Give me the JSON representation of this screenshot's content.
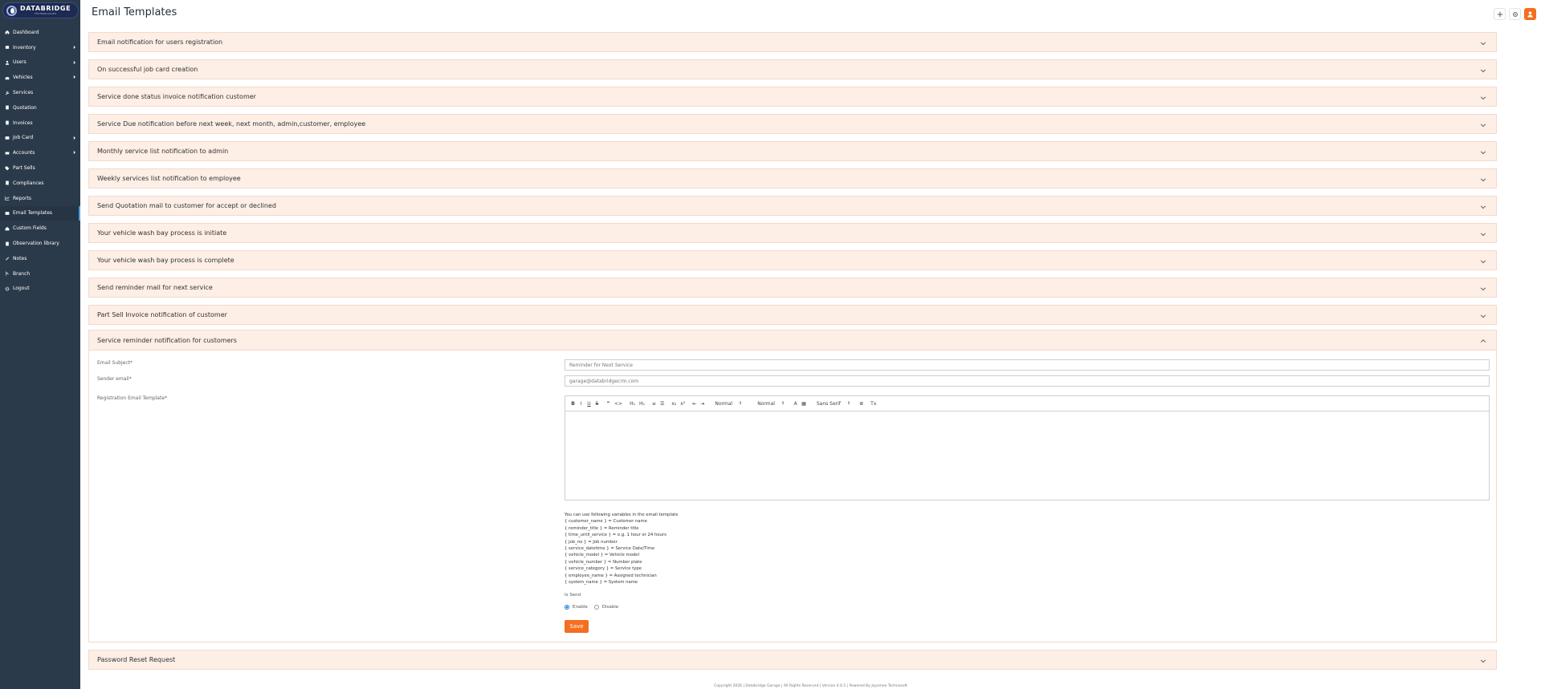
{
  "brand": {
    "name": "DATABRIDGE",
    "tagline": "TECHNOLOGIES"
  },
  "page": {
    "title": "Email Templates"
  },
  "sidebar": {
    "items": [
      {
        "label": "Dashboard",
        "icon": "home-icon",
        "has_children": false
      },
      {
        "label": "Inventory",
        "icon": "box-icon",
        "has_children": true
      },
      {
        "label": "Users",
        "icon": "user-icon",
        "has_children": true
      },
      {
        "label": "Vehicles",
        "icon": "car-icon",
        "has_children": true
      },
      {
        "label": "Services",
        "icon": "wrench-icon",
        "has_children": false
      },
      {
        "label": "Quotation",
        "icon": "document-icon",
        "has_children": false
      },
      {
        "label": "Invoices",
        "icon": "invoice-icon",
        "has_children": false
      },
      {
        "label": "Job Card",
        "icon": "card-icon",
        "has_children": true
      },
      {
        "label": "Accounts",
        "icon": "money-icon",
        "has_children": true
      },
      {
        "label": "Part Sells",
        "icon": "tag-icon",
        "has_children": false
      },
      {
        "label": "Compliances",
        "icon": "file-icon",
        "has_children": false
      },
      {
        "label": "Reports",
        "icon": "chart-icon",
        "has_children": false
      },
      {
        "label": "Email Templates",
        "icon": "email-icon",
        "has_children": false,
        "active": true
      },
      {
        "label": "Custom Fields",
        "icon": "field-icon",
        "has_children": false
      },
      {
        "label": "Observation library",
        "icon": "book-icon",
        "has_children": false
      },
      {
        "label": "Notes",
        "icon": "note-icon",
        "has_children": false
      },
      {
        "label": "Branch",
        "icon": "branch-icon",
        "has_children": false
      },
      {
        "label": "Logout",
        "icon": "power-icon",
        "has_children": false
      }
    ]
  },
  "accordions": [
    "Email notification for users registration",
    "On successful job card creation",
    "Service done status invoice notification customer",
    "Service Due notification before next week, next month, admin,customer, employee",
    "Monthly service list notification to admin",
    "Weekly services list notification to employee",
    "Send Quotation mail to customer for accept or declined",
    "Your vehicle wash bay process is initiate",
    "Your vehicle wash bay process is complete",
    "Send reminder mail for next service",
    "Part Sell Invoice notification of customer"
  ],
  "open_section": {
    "title": "Service reminder notification for customers",
    "subject_label": "Email Subject*",
    "subject_value": "Reminder for Next Service",
    "sender_label": "Sender email*",
    "sender_value": "garage@databridgecrm.com",
    "template_label": "Registration Email Template*",
    "toolbar": {
      "bold": "B",
      "italic": "I",
      "underline": "U",
      "strike": "S",
      "quote": "❞",
      "code": "<>",
      "h1": "H₁",
      "h2": "H₂",
      "ol": "≡",
      "ul": "☰",
      "sub": "x₂",
      "sup": "x²",
      "indent_out": "⇤",
      "indent_in": "⇥",
      "size_value": "Normal",
      "header_value": "Normal",
      "color": "A",
      "bg": "▦",
      "font_value": "Sans Serif",
      "align": "≣",
      "clean": "Tx"
    },
    "vars_intro": "You can use following variables in the email template",
    "vars": [
      "{ customer_name } = Customer name",
      "{ reminder_title } = Reminder title",
      "{ time_until_service } = e.g. 1 hour or 24 hours",
      "{ job_no } = Job number",
      "{ service_datetime } = Service Date/Time",
      "{ vehicle_model } = Vehicle model",
      "{ vehicle_number } = Number plate",
      "{ service_category } = Service type",
      "{ employee_name } = Assigned technician",
      "{ system_name } = System name"
    ],
    "is_send_label": "Is Send",
    "enable_label": "Enable",
    "disable_label": "Disable",
    "save_label": "Save"
  },
  "last_section": {
    "title": "Password Reset Request"
  },
  "footer": {
    "text": "Copyright 2026 | Databridge Garage | All Rights Reserved | Version 4.6.5 | Powered By Jaysmee Technosoft"
  },
  "colors": {
    "sidebar": "#2b3a4a",
    "accent": "#f36f21",
    "accordion_bg": "#fdeee6"
  }
}
